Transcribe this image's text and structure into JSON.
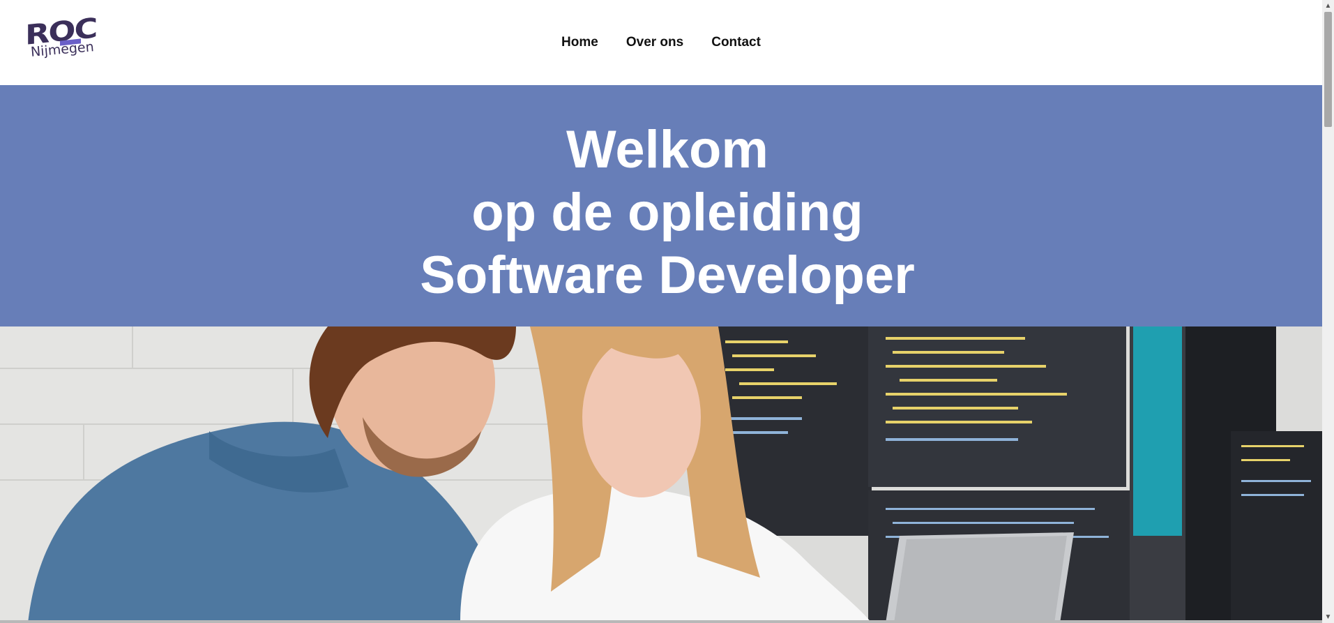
{
  "logo": {
    "main": "ROC",
    "sub": "Nijmegen"
  },
  "nav": {
    "items": [
      {
        "label": "Home"
      },
      {
        "label": "Over ons"
      },
      {
        "label": "Contact"
      }
    ]
  },
  "hero": {
    "lines": [
      "Welkom",
      "op de opleiding",
      "Software Developer"
    ]
  },
  "photo": {
    "alt": "Twee studenten achter een laptop met code op schermen"
  },
  "colors": {
    "hero_bg": "#677eb8",
    "logo": "#3b2f5a",
    "accent": "#6a5fc8"
  },
  "icons": {
    "scroll_up": "chevron-up-icon",
    "scroll_down": "chevron-down-icon"
  }
}
